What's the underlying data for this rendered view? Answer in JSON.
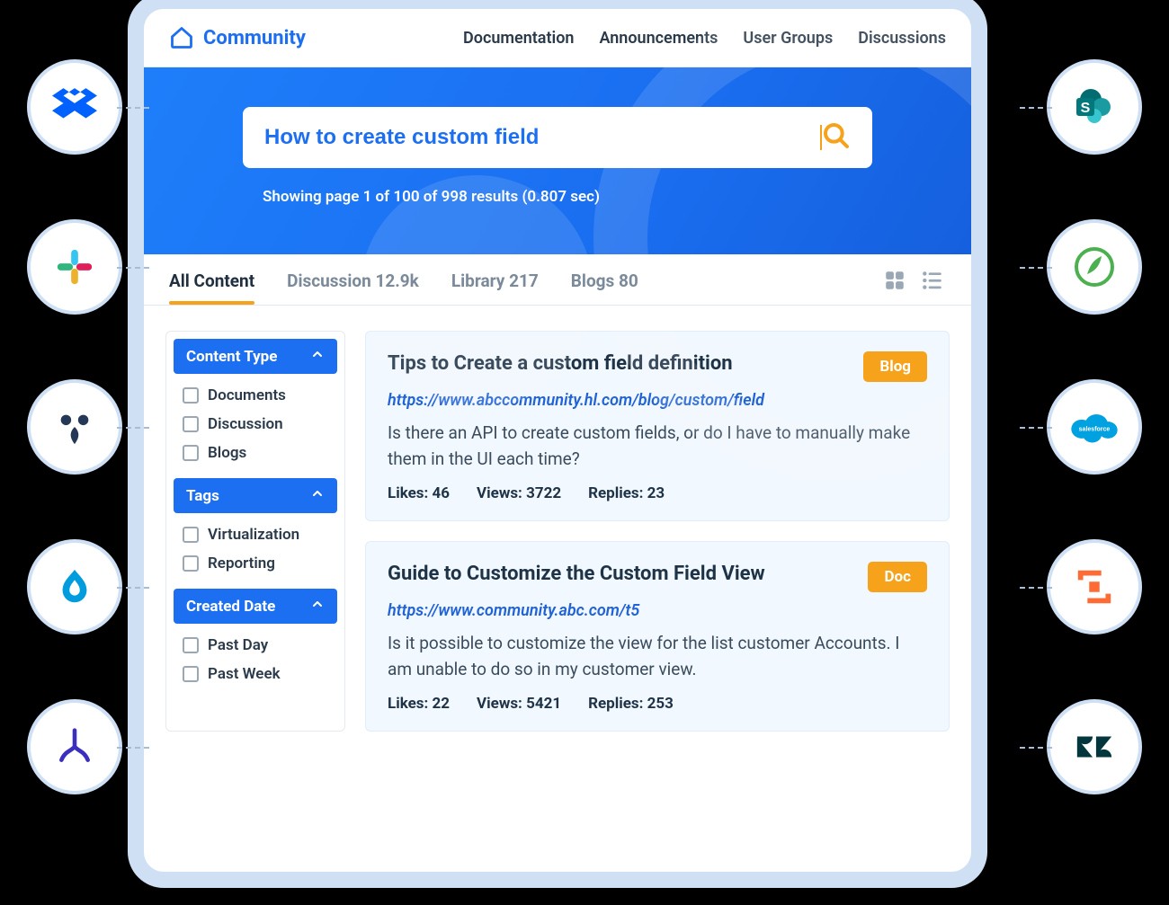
{
  "brand": {
    "name": "Community"
  },
  "nav": {
    "items": [
      "Documentation",
      "Announcements",
      "User Groups",
      "Discussions"
    ]
  },
  "search": {
    "query": "How to create custom field",
    "summary": "Showing page 1 of 100 of 998 results (0.807 sec)"
  },
  "tabs": [
    {
      "label": "All Content",
      "count": "",
      "active": true
    },
    {
      "label": "Discussion",
      "count": "12.9k",
      "active": false
    },
    {
      "label": "Library",
      "count": "217",
      "active": false
    },
    {
      "label": "Blogs",
      "count": "80",
      "active": false
    }
  ],
  "filters": [
    {
      "title": "Content Type",
      "items": [
        "Documents",
        "Discussion",
        "Blogs"
      ]
    },
    {
      "title": "Tags",
      "items": [
        "Virtualization",
        "Reporting"
      ]
    },
    {
      "title": "Created Date",
      "items": [
        "Past Day",
        "Past Week"
      ]
    }
  ],
  "results": [
    {
      "title": "Tips to Create a custom field definition",
      "badge": "Blog",
      "url": "https://www.abccommunity.hl.com/blog/custom/field",
      "snippet": "Is there an API to create custom fields, or do I have to manually make them in the UI each time?",
      "likes": "Likes: 46",
      "views": "Views: 3722",
      "replies": "Replies: 23"
    },
    {
      "title": "Guide to Customize the Custom Field View",
      "badge": "Doc",
      "url": "https://www.community.abc.com/t5",
      "snippet": "Is it possible to customize the view for the list customer Accounts. I am unable to do so in my customer view.",
      "likes": "Likes: 22",
      "views": "Views: 5421",
      "replies": "Replies: 253"
    }
  ],
  "integrations": {
    "left": [
      "dropbox",
      "slack",
      "jira",
      "drupal",
      "branch"
    ],
    "right": [
      "sharepoint",
      "piedpiper",
      "salesforce",
      "square",
      "zendesk"
    ]
  }
}
